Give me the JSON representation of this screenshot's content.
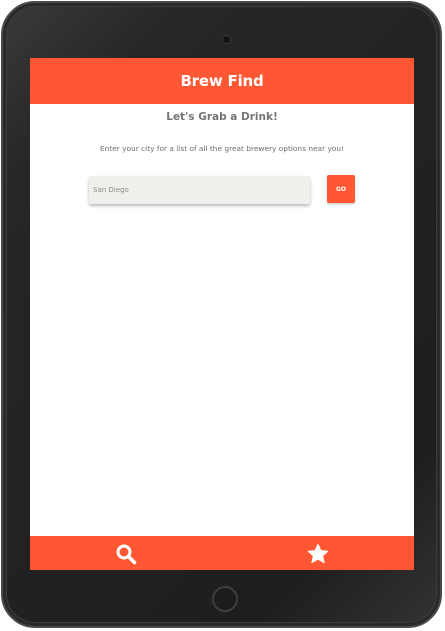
{
  "app": {
    "title": "Brew Find"
  },
  "main": {
    "subtitle": "Let's Grab a Drink!",
    "instructions": "Enter your city for a list of all the great brewery options near you!",
    "search": {
      "value": "",
      "placeholder": "San Diego"
    },
    "go_label": "GO"
  },
  "footer": {
    "items": [
      {
        "icon": "search-icon"
      },
      {
        "icon": "star-icon"
      }
    ]
  },
  "colors": {
    "accent": "#ff5733",
    "input_background": "#f1efec",
    "text_muted": "#757575"
  }
}
